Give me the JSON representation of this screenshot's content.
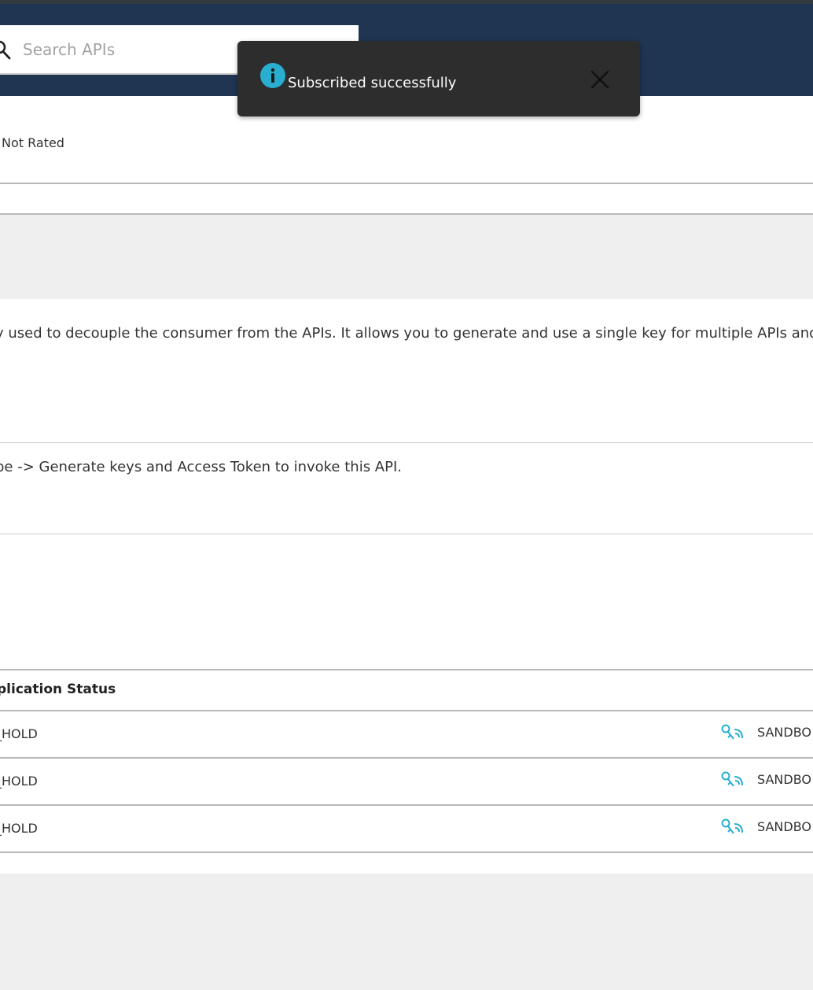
{
  "search": {
    "placeholder": "Search APIs"
  },
  "toast": {
    "message": "Subscribed successfully"
  },
  "api": {
    "rating": "Not Rated"
  },
  "content": {
    "description": "y used to decouple the consumer from the APIs. It allows you to generate and use a single key for multiple APIs and s",
    "invoke_instruction": "be -> Generate keys and Access Token to invoke this API."
  },
  "subscriptions": {
    "column_header": "plication Status",
    "rows": [
      {
        "status": "_HOLD",
        "key_type": "SANDBO"
      },
      {
        "status": "_HOLD",
        "key_type": "SANDBO"
      },
      {
        "status": "_HOLD",
        "key_type": "SANDBO"
      }
    ]
  },
  "colors": {
    "header_bg": "#1f3552",
    "toast_bg": "#2d2d2d",
    "info_accent": "#29aed0",
    "page_band": "#efefef"
  },
  "icons": {
    "search": "search-icon",
    "info": "info-icon",
    "close": "close-icon",
    "key_type": "sandbox-key-icon"
  }
}
